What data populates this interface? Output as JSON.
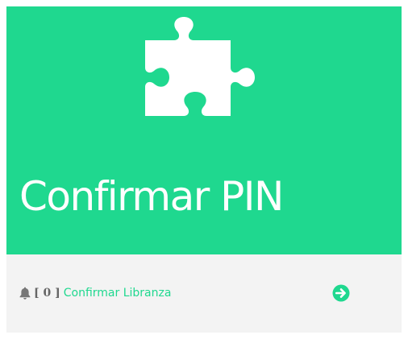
{
  "card": {
    "title": "Confirmar PIN",
    "icon": "puzzle-piece-icon",
    "footer": {
      "bell_icon": "bell-icon",
      "count_open": "[",
      "count": "0",
      "count_close": "]",
      "link_label": "Confirmar Libranza",
      "action_icon": "arrow-circle-right-icon"
    }
  },
  "colors": {
    "accent": "#1fd88f",
    "footer_bg": "#f3f3f3",
    "count_text": "#666666",
    "bell": "#777777"
  }
}
